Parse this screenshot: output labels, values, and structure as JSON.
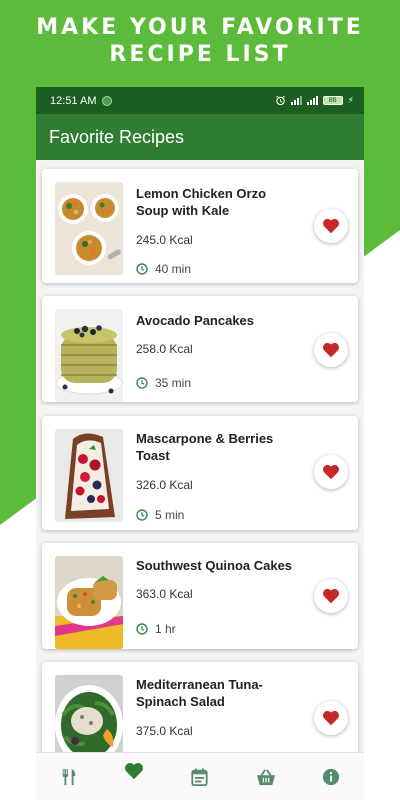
{
  "promo": {
    "line1": "MAKE YOUR FAVORITE",
    "line2": "RECIPE LIST"
  },
  "colors": {
    "promo_green": "#5dbb3c",
    "status_bar": "#1b5e20",
    "app_bar": "#2e7d32",
    "heart": "#c62828",
    "icon_green": "#558b6e"
  },
  "status_bar": {
    "time": "12:51 AM",
    "battery": "86"
  },
  "app_bar": {
    "title": "Favorite Recipes"
  },
  "recipes": [
    {
      "name": "Lemon Chicken Orzo Soup with Kale",
      "kcal": "245.0 Kcal",
      "time": "40 min"
    },
    {
      "name": "Avocado Pancakes",
      "kcal": "258.0 Kcal",
      "time": "35 min"
    },
    {
      "name": "Mascarpone & Berries Toast",
      "kcal": "326.0 Kcal",
      "time": "5 min"
    },
    {
      "name": "Southwest Quinoa Cakes",
      "kcal": "363.0 Kcal",
      "time": "1 hr"
    },
    {
      "name": "Mediterranean Tuna-Spinach Salad",
      "kcal": "375.0 Kcal",
      "time": ""
    }
  ],
  "bottom_nav": [
    {
      "icon": "utensils-icon",
      "active": false
    },
    {
      "icon": "heart-icon",
      "active": true
    },
    {
      "icon": "calendar-icon",
      "active": false
    },
    {
      "icon": "basket-icon",
      "active": false
    },
    {
      "icon": "info-icon",
      "active": false
    }
  ]
}
